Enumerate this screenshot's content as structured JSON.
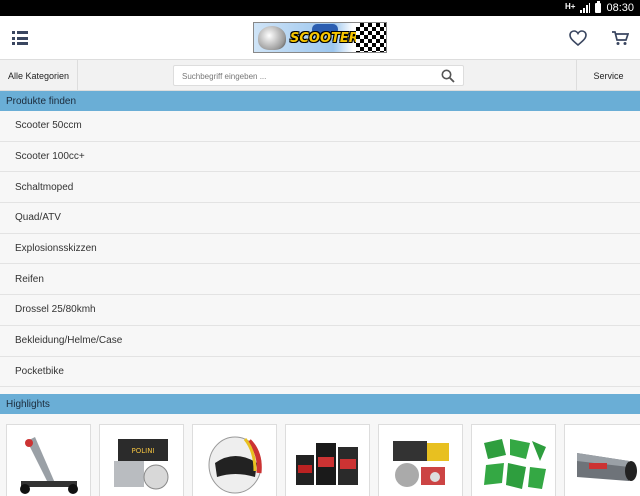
{
  "statusbar": {
    "network": "H+",
    "time": "08:30"
  },
  "header": {
    "logo_text": "SCOOTER"
  },
  "catbar": {
    "categories_label": "Alle Kategorien",
    "search_placeholder": "Suchbegriff eingeben ...",
    "service_label": "Service"
  },
  "products": {
    "title": "Produkte finden",
    "items": [
      "Scooter 50ccm",
      "Scooter 100cc+",
      "Schaltmoped",
      "Quad/ATV",
      "Explosionsskizzen",
      "Reifen",
      "Drossel 25/80kmh",
      "Bekleidung/Helme/Case",
      "Pocketbike"
    ]
  },
  "highlights": {
    "title": "Highlights",
    "items": [
      "scooter-stand",
      "cylinder-kit",
      "helmet",
      "oil-set",
      "engine-parts-kit",
      "green-fairing-kit",
      "exhaust"
    ]
  },
  "colors": {
    "section_header": "#6aaed6",
    "statusbar": "#000000",
    "icon": "#3a4660"
  }
}
